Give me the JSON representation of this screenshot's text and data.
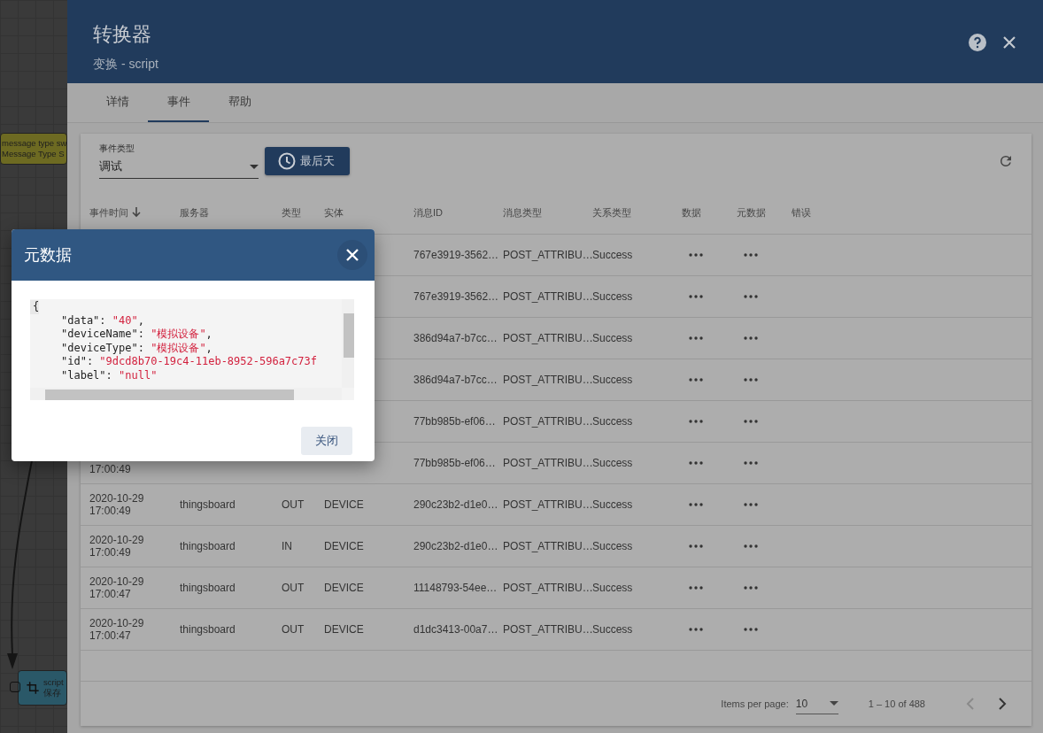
{
  "canvas": {
    "nodes": [
      {
        "kind": "filter",
        "lines": [
          "message type sw",
          "Message Type S"
        ]
      },
      {
        "kind": "transform",
        "lines": [
          "script",
          "保存"
        ]
      }
    ]
  },
  "panel": {
    "title": "转换器",
    "subtitle": "变换 - script",
    "tabs": [
      {
        "label": "详情",
        "selected": false
      },
      {
        "label": "事件",
        "selected": true
      },
      {
        "label": "帮助",
        "selected": false
      }
    ],
    "filter": {
      "label": "事件类型",
      "value": "调试"
    },
    "time_button": "最后天",
    "table": {
      "columns": [
        {
          "label": "事件时间",
          "sorted": true
        },
        {
          "label": "服务器",
          "sorted": false
        },
        {
          "label": "类型",
          "sorted": false
        },
        {
          "label": "实体",
          "sorted": false
        },
        {
          "label": "消息ID",
          "sorted": false
        },
        {
          "label": "消息类型",
          "sorted": false
        },
        {
          "label": "关系类型",
          "sorted": false
        },
        {
          "label": "数据",
          "sorted": false
        },
        {
          "label": "元数据",
          "sorted": false
        },
        {
          "label": "错误",
          "sorted": false
        }
      ],
      "rows": [
        {
          "time": [],
          "server": "",
          "type": "",
          "entity": "",
          "message_id": "767e3919-3562…",
          "message_type": "POST_ATTRIBU…",
          "relation_type": "Success"
        },
        {
          "time": [],
          "server": "",
          "type": "",
          "entity": "",
          "message_id": "767e3919-3562…",
          "message_type": "POST_ATTRIBU…",
          "relation_type": "Success"
        },
        {
          "time": [],
          "server": "",
          "type": "",
          "entity": "",
          "message_id": "386d94a7-b7cc…",
          "message_type": "POST_ATTRIBU…",
          "relation_type": "Success"
        },
        {
          "time": [],
          "server": "",
          "type": "",
          "entity": "",
          "message_id": "386d94a7-b7cc…",
          "message_type": "POST_ATTRIBU…",
          "relation_type": "Success"
        },
        {
          "time": [],
          "server": "",
          "type": "",
          "entity": "",
          "message_id": "77bb985b-ef06…",
          "message_type": "POST_ATTRIBU…",
          "relation_type": "Success"
        },
        {
          "time": [
            "17:00:49"
          ],
          "server": "",
          "type": "",
          "entity": "",
          "message_id": "77bb985b-ef06…",
          "message_type": "POST_ATTRIBU…",
          "relation_type": "Success"
        },
        {
          "time": [
            "2020-10-29",
            "17:00:49"
          ],
          "server": "thingsboard",
          "type": "OUT",
          "entity": "DEVICE",
          "message_id": "290c23b2-d1e0…",
          "message_type": "POST_ATTRIBU…",
          "relation_type": "Success"
        },
        {
          "time": [
            "2020-10-29",
            "17:00:49"
          ],
          "server": "thingsboard",
          "type": "IN",
          "entity": "DEVICE",
          "message_id": "290c23b2-d1e0…",
          "message_type": "POST_ATTRIBU…",
          "relation_type": "Success"
        },
        {
          "time": [
            "2020-10-29",
            "17:00:47"
          ],
          "server": "thingsboard",
          "type": "OUT",
          "entity": "DEVICE",
          "message_id": "11148793-54ee…",
          "message_type": "POST_ATTRIBU…",
          "relation_type": "Success"
        },
        {
          "time": [
            "2020-10-29",
            "17:00:47"
          ],
          "server": "thingsboard",
          "type": "OUT",
          "entity": "DEVICE",
          "message_id": "d1dc3413-00a7…",
          "message_type": "POST_ATTRIBU…",
          "relation_type": "Success"
        }
      ]
    },
    "paginator": {
      "label": "Items per page:",
      "page_size": "10",
      "range": "1 – 10 of 488"
    }
  },
  "dialog": {
    "title": "元数据",
    "close_button": "关闭",
    "code_lines": [
      {
        "kind": "brace",
        "text": "{"
      },
      {
        "kind": "pair",
        "key": "\"data\": ",
        "value": "\"40\"",
        "tail": ","
      },
      {
        "kind": "pair",
        "key": "\"deviceName\": ",
        "value": "\"模拟设备\"",
        "tail": ","
      },
      {
        "kind": "pair",
        "key": "\"deviceType\": ",
        "value": "\"模拟设备\"",
        "tail": ","
      },
      {
        "kind": "pair",
        "key": "\"id\": ",
        "value": "\"9dcd8b70-19c4-11eb-8952-596a7c73f"
      },
      {
        "kind": "pair",
        "key": "\"label\": ",
        "value": "\"null\""
      }
    ]
  }
}
